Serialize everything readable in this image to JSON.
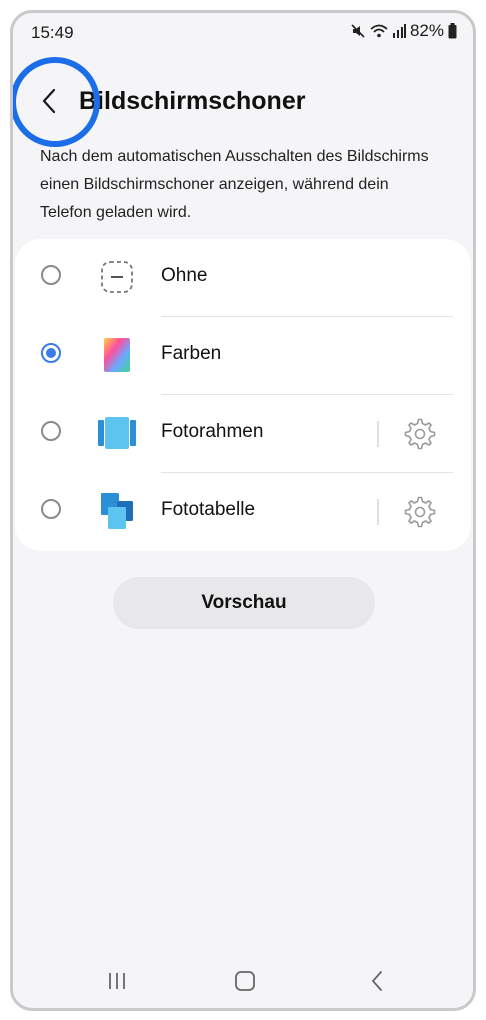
{
  "status_bar": {
    "time": "15:49",
    "battery": "82%",
    "icons": [
      "mute-icon",
      "wifi-icon",
      "signal-icon",
      "battery-icon"
    ]
  },
  "header": {
    "title": "Bildschirmschoner",
    "back_icon": "chevron-left-icon"
  },
  "description": "Nach dem automatischen Ausschalten des Bildschirms einen Bildschirmschoner anzeigen, während dein Telefon geladen wird.",
  "options": [
    {
      "label": "Ohne",
      "icon": "none-icon",
      "selected": false,
      "has_settings": false
    },
    {
      "label": "Farben",
      "icon": "colors-icon",
      "selected": true,
      "has_settings": false
    },
    {
      "label": "Fotorahmen",
      "icon": "photo-frame-icon",
      "selected": false,
      "has_settings": true
    },
    {
      "label": "Fototabelle",
      "icon": "photo-table-icon",
      "selected": false,
      "has_settings": true
    }
  ],
  "preview_button": "Vorschau",
  "navigation": [
    "recent-apps-icon",
    "home-icon",
    "back-icon"
  ],
  "colors": {
    "accent": "#3b7be6",
    "highlight_ring": "#1b6ee8",
    "background": "#f5f5f7",
    "card": "#ffffff"
  }
}
